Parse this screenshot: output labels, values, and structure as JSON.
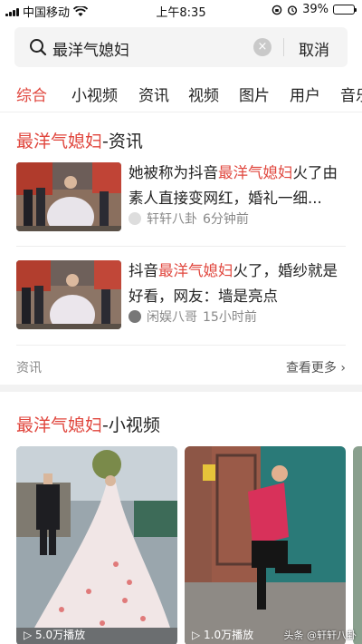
{
  "status_bar": {
    "carrier": "中国移动",
    "time": "上午8:35",
    "battery": "39%",
    "battery_level": 0.39,
    "icons": [
      "wifi-icon",
      "rotation-lock-icon",
      "alarm-icon",
      "battery-icon"
    ]
  },
  "search": {
    "query": "最洋气媳妇",
    "cancel_label": "取消",
    "clear_label": "×"
  },
  "tabs": [
    {
      "label": "综合",
      "active": true
    },
    {
      "label": "小视频"
    },
    {
      "label": "资讯"
    },
    {
      "label": "视频"
    },
    {
      "label": "图片"
    },
    {
      "label": "用户"
    },
    {
      "label": "音乐"
    }
  ],
  "news_section": {
    "title_highlight": "最洋气媳妇",
    "title_suffix": "-资讯",
    "items": [
      {
        "pre": "她被称为抖音",
        "highlight": "最洋气媳妇",
        "post": "火了由素人直接变网红，婚礼一细...",
        "source": "轩轩八卦",
        "time": "6分钟前"
      },
      {
        "pre": "抖音",
        "highlight": "最洋气媳妇",
        "post": "火了，婚纱就是好看，网友：墙是亮点",
        "source": "闲娱八哥",
        "time": "15小时前"
      }
    ],
    "footer_label": "资讯",
    "more_label": "查看更多 ›"
  },
  "video_section": {
    "title_highlight": "最洋气媳妇",
    "title_suffix": "-小视频",
    "cards": [
      {
        "caption": "▷ 5.0万播放"
      },
      {
        "caption": "▷ 1.0万播放"
      }
    ],
    "watermark": "头条 @轩轩八卦"
  },
  "colors": {
    "accent": "#e0463d",
    "text": "#222222",
    "muted": "#888888",
    "search_bg": "#f4f4f4",
    "section_gap": "#f2f2f2"
  }
}
